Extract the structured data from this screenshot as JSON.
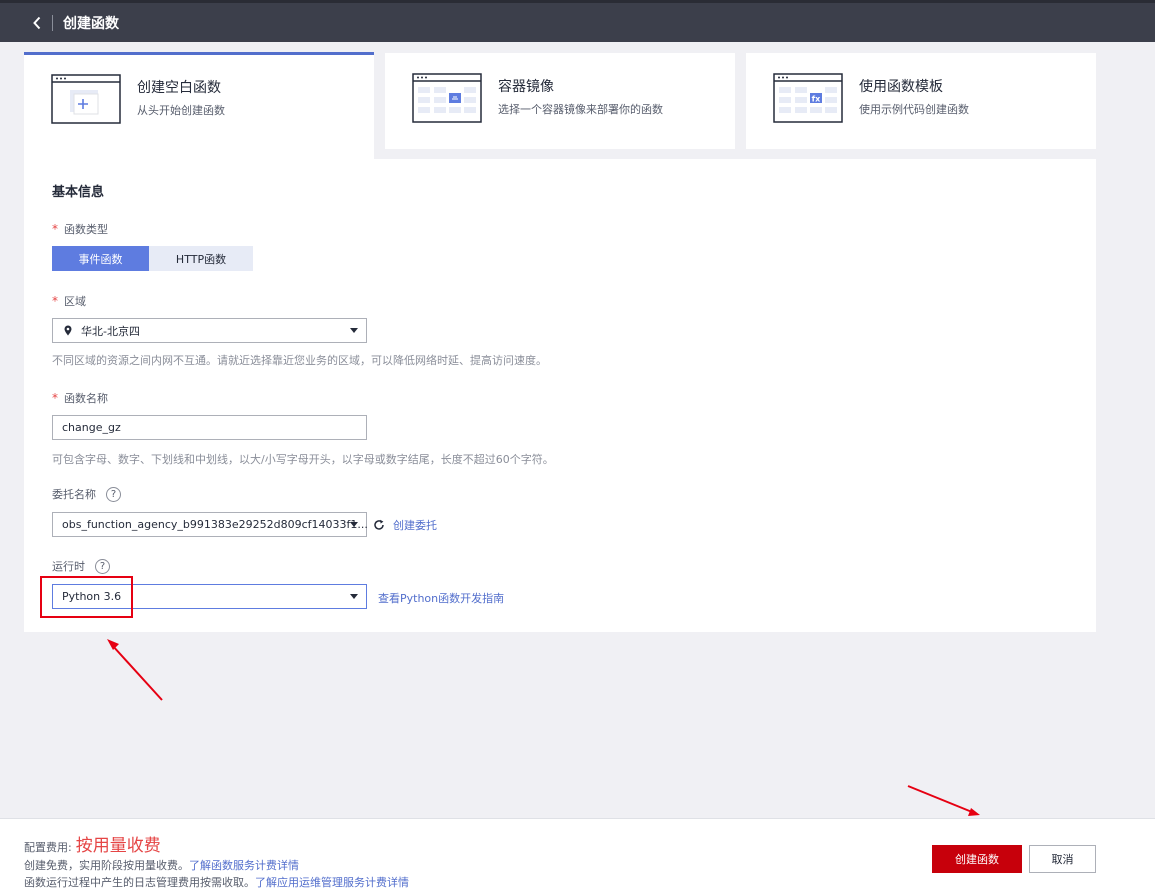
{
  "header": {
    "title": "创建函数",
    "back_icon": "chevron-left-icon"
  },
  "creation_modes": [
    {
      "title": "创建空白函数",
      "desc": "从头开始创建函数",
      "icon": "blank-function-icon",
      "active": true
    },
    {
      "title": "容器镜像",
      "desc": "选择一个容器镜像来部署你的函数",
      "icon": "container-image-icon",
      "active": false
    },
    {
      "title": "使用函数模板",
      "desc": "使用示例代码创建函数",
      "icon": "function-template-icon",
      "active": false
    }
  ],
  "basic_info": {
    "title": "基本信息",
    "function_type": {
      "label": "函数类型",
      "required_mark": "*",
      "options": [
        "事件函数",
        "HTTP函数"
      ],
      "selected": "事件函数"
    },
    "region": {
      "label": "区域",
      "required_mark": "*",
      "value": "华北-北京四",
      "hint": "不同区域的资源之间内网不互通。请就近选择靠近您业务的区域，可以降低网络时延、提高访问速度。"
    },
    "function_name": {
      "label": "函数名称",
      "required_mark": "*",
      "value": "change_gz",
      "hint": "可包含字母、数字、下划线和中划线，以大/小写字母开头，以字母或数字结尾，长度不超过60个字符。"
    },
    "agency": {
      "label": "委托名称",
      "help": "?",
      "value": "obs_function_agency_b991383e29252d809cf14033f1...",
      "create_link": "创建委托"
    },
    "runtime": {
      "label": "运行时",
      "help": "?",
      "value": "Python 3.6",
      "guide_link": "查看Python函数开发指南"
    }
  },
  "footer": {
    "fee_label": "配置费用:",
    "fee_value": "按用量收费",
    "line1_text": "创建免费，实用阶段按用量收费。",
    "line1_link": "了解函数服务计费详情",
    "line2_text": "函数运行过程中产生的日志管理费用按需收取。",
    "line2_link": "了解应用运维管理服务计费详情",
    "create_button": "创建函数",
    "cancel_button": "取消"
  },
  "colors": {
    "accent": "#5e7ce0",
    "primary_button": "#c7000b",
    "annotation": "#e60012",
    "topbar": "#3c3f4b"
  }
}
